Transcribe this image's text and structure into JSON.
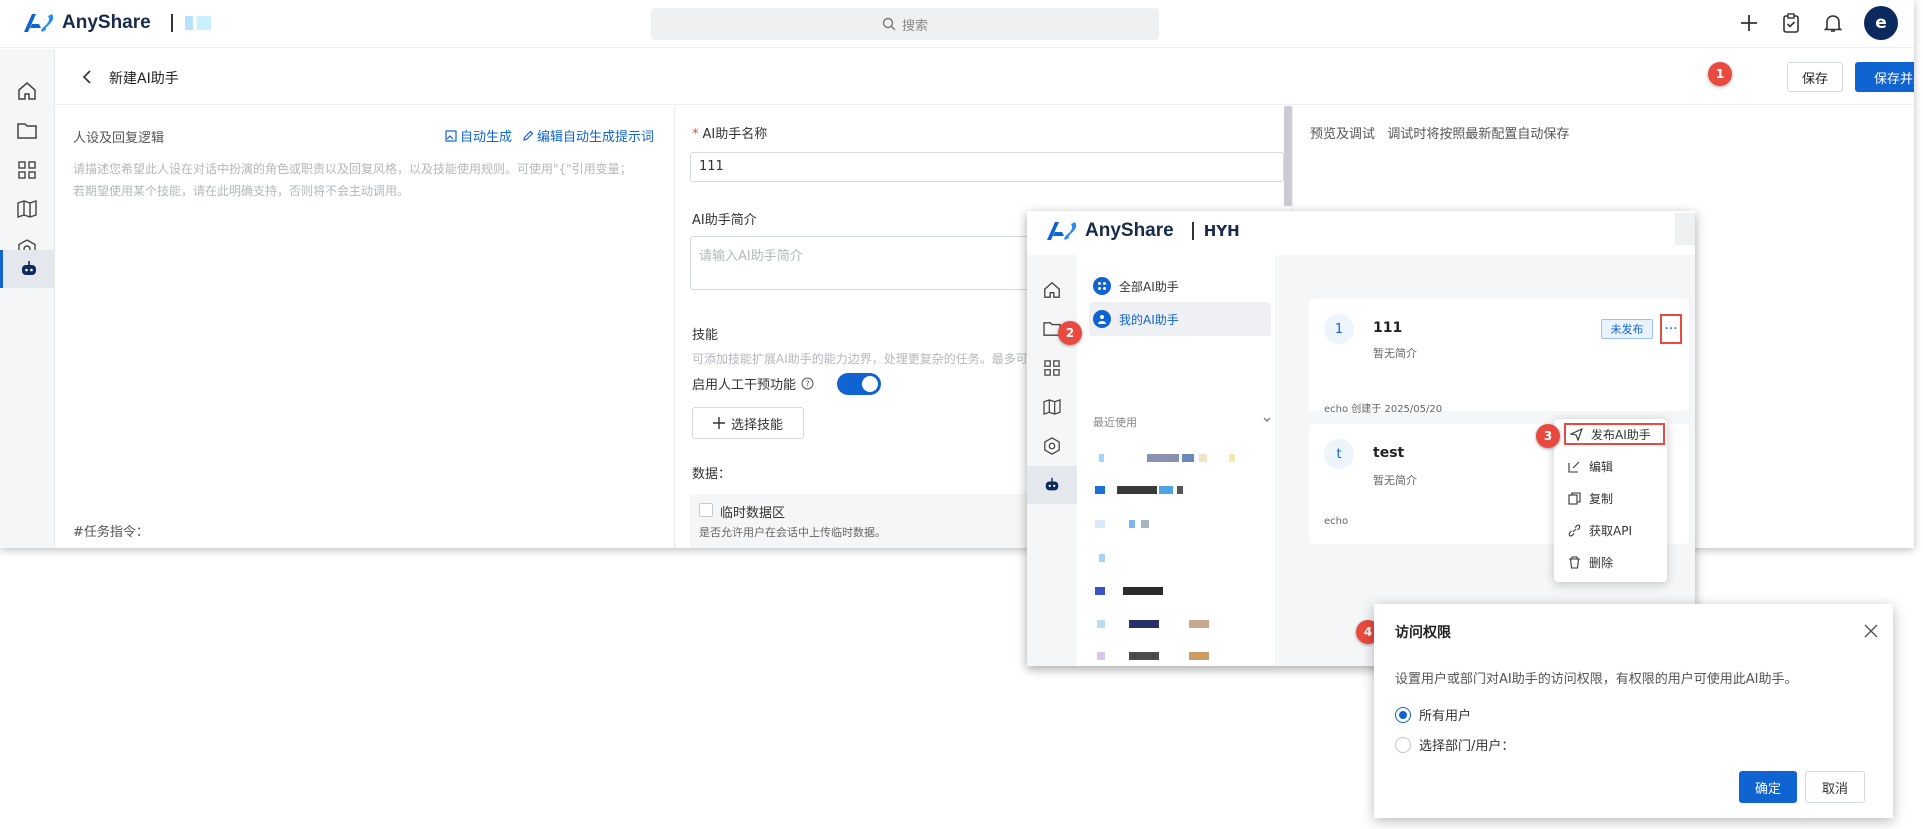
{
  "app": {
    "name": "AnyShare",
    "org": "HYH"
  },
  "search": {
    "placeholder": "搜索"
  },
  "user": {
    "avatar_letter": "e"
  },
  "editor": {
    "back_label": "<",
    "title": "新建AI助手",
    "save_label": "保存",
    "publish_label": "保存并发布"
  },
  "persona": {
    "heading": "人设及回复逻辑",
    "auto_generate": "自动生成",
    "edit_prompt": "编辑自动生成提示词",
    "placeholder": "请描述您希望此人设在对话中扮演的角色或职责以及回复风格，以及技能使用规则。可使用\"{\"引用变量；若期望使用某个技能，请在此明确支持，否则将不会主动调用。",
    "task_label": "#任务指令："
  },
  "form": {
    "required_mark": "*",
    "name_label": "AI助手名称",
    "name_value": "111",
    "intro_label": "AI助手简介",
    "intro_placeholder": "请输入AI助手简介",
    "skills_label": "技能",
    "skills_hint": "可添加技能扩展AI助手的能力边界，处理更复杂的任务。最多可",
    "manual_label": "启用人工干预功能",
    "select_skill": "选择技能",
    "data_label": "数据：",
    "temp_data_label": "临时数据区",
    "temp_data_hint": "是否允许用户在会话中上传临时数据。"
  },
  "preview": {
    "heading": "预览及调试",
    "note": "调试时将按照最新配置自动保存"
  },
  "assistants": {
    "all_label": "全部AI助手",
    "mine_label": "我的AI助手",
    "recent_label": "最近使用",
    "cards": [
      {
        "icon_letter": "1",
        "name": "111",
        "intro": "暂无简介",
        "status": "未发布",
        "meta": "echo 创建于 2025/05/20",
        "more": "···"
      },
      {
        "icon_letter": "t",
        "name": "test",
        "intro": "暂无简介",
        "meta": "echo"
      }
    ]
  },
  "menu": {
    "items": [
      {
        "label": "发布AI助手",
        "icon": "send-icon"
      },
      {
        "label": "编辑",
        "icon": "edit-icon"
      },
      {
        "label": "复制",
        "icon": "copy-icon"
      },
      {
        "label": "获取API",
        "icon": "link-icon"
      },
      {
        "label": "删除",
        "icon": "trash-icon"
      }
    ]
  },
  "dialog": {
    "title": "访问权限",
    "desc": "设置用户或部门对AI助手的访问权限，有权限的用户可使用此AI助手。",
    "option_all": "所有用户",
    "option_select": "选择部门/用户：",
    "ok": "确定",
    "cancel": "取消"
  },
  "steps": [
    "1",
    "2",
    "3",
    "4"
  ],
  "colors": {
    "primary": "#1064d2",
    "step": "#e84a3f",
    "brand_dark": "#1a2a4a"
  }
}
